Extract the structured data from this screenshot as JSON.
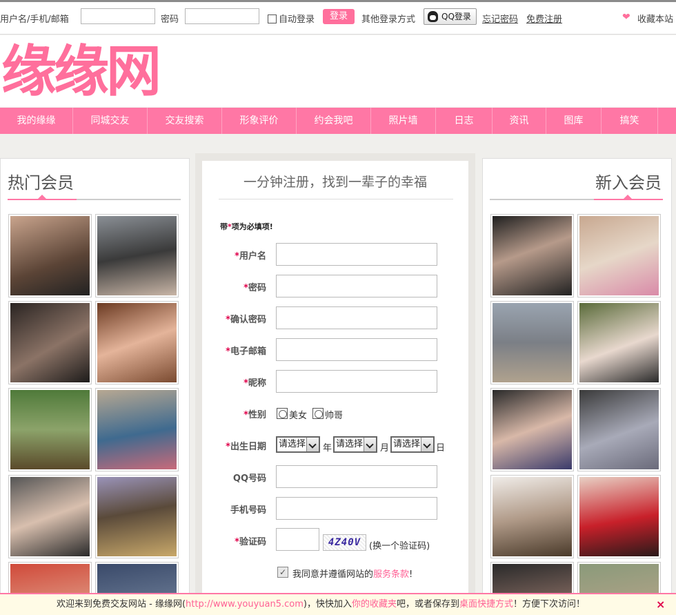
{
  "topbar": {
    "username_label": "用户名/手机/邮箱",
    "password_label": "密码",
    "auto_login_label": "自动登录",
    "login_button": "登录",
    "other_login_label": "其他登录方式",
    "qq_login_button": "QQ登录",
    "forgot_password": "忘记密码",
    "free_register": "免费注册",
    "bookmark_site": "收藏本站"
  },
  "logo": {
    "text": "缘缘网"
  },
  "nav": {
    "items": [
      "我的缘缘",
      "同城交友",
      "交友搜索",
      "形象评价",
      "约会我吧",
      "照片墙",
      "日志",
      "资讯",
      "图库",
      "搞笑"
    ]
  },
  "left_panel": {
    "title": "热门会员"
  },
  "right_panel": {
    "title": "新入会员"
  },
  "form": {
    "title": "一分钟注册，找到一辈子的幸福",
    "required_note_prefix": "带",
    "required_note_star": "*",
    "required_note_suffix": "项为必填项!",
    "star": "*",
    "fields": {
      "username": "用户名",
      "password": "密码",
      "confirm_password": "确认密码",
      "email": "电子邮箱",
      "nickname": "昵称",
      "gender": "性别",
      "birthday": "出生日期",
      "qq": "QQ号码",
      "phone": "手机号码",
      "captcha": "验证码"
    },
    "gender_options": {
      "female": "美女",
      "male": "帅哥"
    },
    "birthday": {
      "select_placeholder": "请选择",
      "year_unit": "年",
      "month_unit": "月",
      "day_unit": "日"
    },
    "captcha_code": "4Z40V",
    "captcha_refresh": "(换一个验证码)",
    "agree_prefix": "我同意并遵循网站的",
    "agree_link": "服务条款",
    "agree_suffix": "!"
  },
  "bottombar": {
    "text_1": "欢迎来到免费交友网站 - 缘缘网(",
    "url": "http://www.youyuan5.com",
    "text_2": ")，快快加入",
    "link_favorites": "你的收藏夹",
    "text_3": "吧，或者保存到",
    "link_desktop": "桌面快捷方式",
    "text_4": "！方便下次访问！",
    "close": "×"
  },
  "colors": {
    "brand_pink": "#ff77a5",
    "logo_pink": "#ff6f9c",
    "required_red": "#e0004b"
  }
}
